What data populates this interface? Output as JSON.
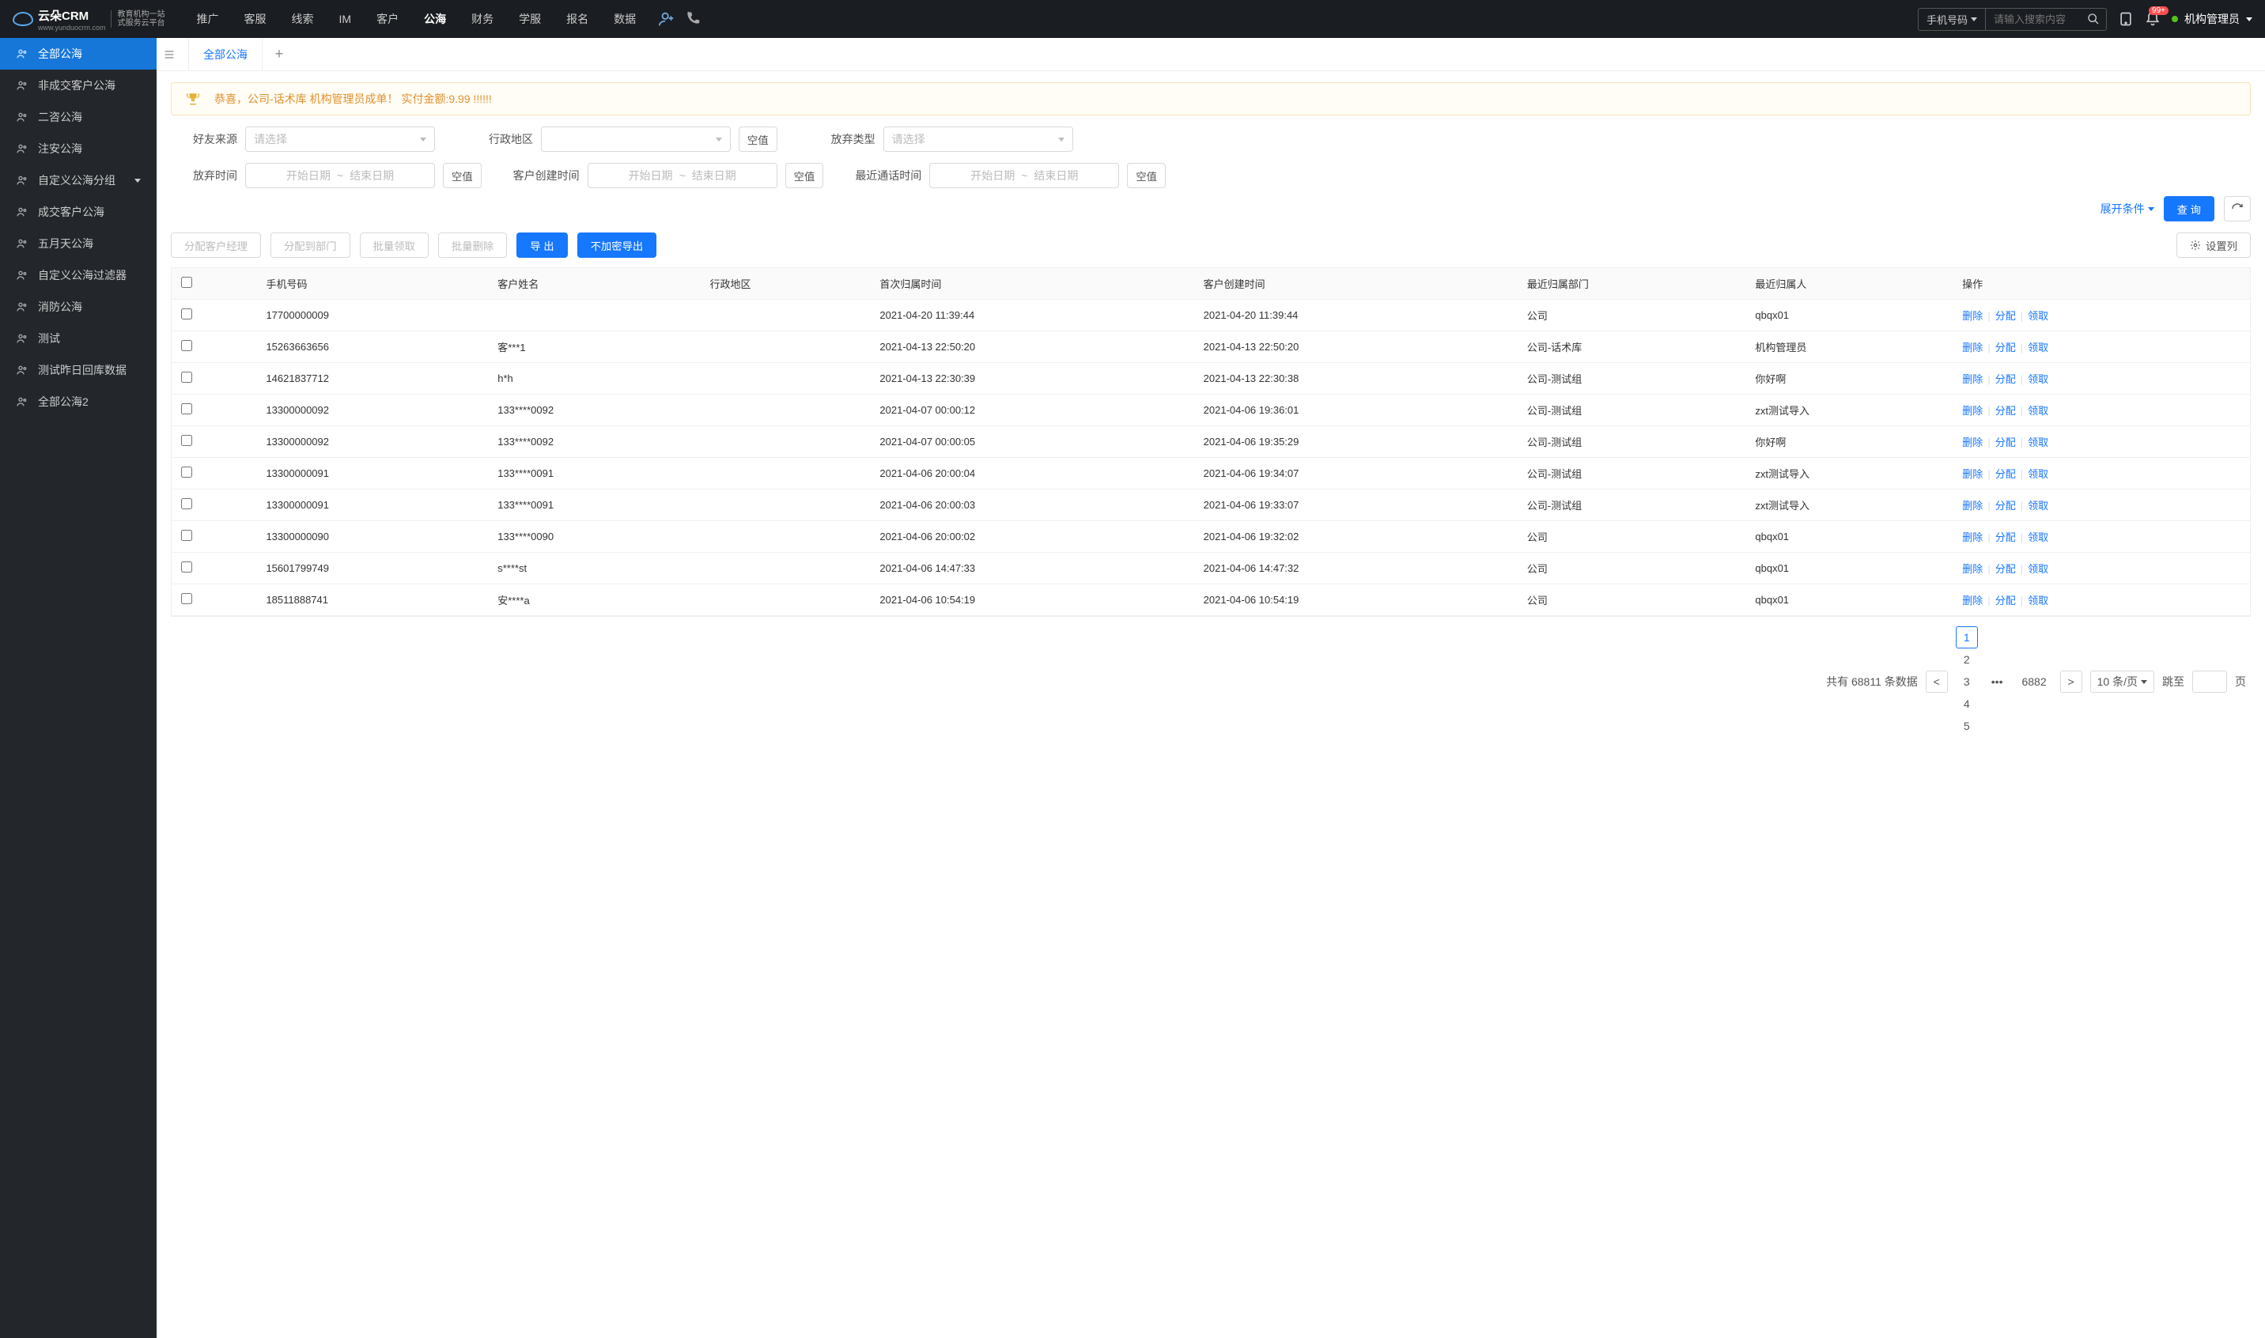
{
  "brand": {
    "name": "云朵CRM",
    "sub1": "教育机构一站",
    "sub2": "式服务云平台",
    "domain": "www.yunduocrm.com"
  },
  "nav": {
    "items": [
      "推广",
      "客服",
      "线索",
      "IM",
      "客户",
      "公海",
      "财务",
      "学服",
      "报名",
      "数据"
    ],
    "active": "公海"
  },
  "topbar": {
    "search_type": "手机号码",
    "search_placeholder": "请输入搜索内容",
    "badge": "99+",
    "user": "机构管理员"
  },
  "sidebar": {
    "items": [
      "全部公海",
      "非成交客户公海",
      "二咨公海",
      "注安公海",
      "自定义公海分组",
      "成交客户公海",
      "五月天公海",
      "自定义公海过滤器",
      "消防公海",
      "测试",
      "测试昨日回库数据",
      "全部公海2"
    ],
    "active": "全部公海",
    "expandable": "自定义公海分组"
  },
  "tabs": {
    "active": "全部公海"
  },
  "banner": {
    "text": "恭喜，公司-话术库  机构管理员成单！  实付金额:9.99 !!!!!!"
  },
  "filters": {
    "labels": {
      "friend_from": "好友来源",
      "region": "行政地区",
      "abandon_type": "放弃类型",
      "abandon_time": "放弃时间",
      "create_time": "客户创建时间",
      "last_call": "最近通话时间"
    },
    "placeholder_select": "请选择",
    "placeholder_start": "开始日期",
    "placeholder_end": "结束日期",
    "empty_btn": "空值",
    "expand": "展开条件",
    "query": "查 询"
  },
  "toolbar": {
    "assign_manager": "分配客户经理",
    "assign_dept": "分配到部门",
    "batch_claim": "批量领取",
    "batch_delete": "批量删除",
    "export": "导 出",
    "export_plain": "不加密导出",
    "set_columns": "设置列"
  },
  "table": {
    "headers": [
      "手机号码",
      "客户姓名",
      "行政地区",
      "首次归属时间",
      "客户创建时间",
      "最近归属部门",
      "最近归属人",
      "操作"
    ],
    "ops": {
      "delete": "删除",
      "assign": "分配",
      "claim": "领取"
    },
    "rows": [
      {
        "phone": "17700000009",
        "name": "",
        "region": "",
        "first": "2021-04-20 11:39:44",
        "created": "2021-04-20 11:39:44",
        "dept": "公司",
        "owner": "qbqx01"
      },
      {
        "phone": "15263663656",
        "name": "客***1",
        "region": "",
        "first": "2021-04-13 22:50:20",
        "created": "2021-04-13 22:50:20",
        "dept": "公司-话术库",
        "owner": "机构管理员"
      },
      {
        "phone": "14621837712",
        "name": "h*h",
        "region": "",
        "first": "2021-04-13 22:30:39",
        "created": "2021-04-13 22:30:38",
        "dept": "公司-测试组",
        "owner": "你好啊"
      },
      {
        "phone": "13300000092",
        "name": "133****0092",
        "region": "",
        "first": "2021-04-07 00:00:12",
        "created": "2021-04-06 19:36:01",
        "dept": "公司-测试组",
        "owner": "zxt测试导入"
      },
      {
        "phone": "13300000092",
        "name": "133****0092",
        "region": "",
        "first": "2021-04-07 00:00:05",
        "created": "2021-04-06 19:35:29",
        "dept": "公司-测试组",
        "owner": "你好啊"
      },
      {
        "phone": "13300000091",
        "name": "133****0091",
        "region": "",
        "first": "2021-04-06 20:00:04",
        "created": "2021-04-06 19:34:07",
        "dept": "公司-测试组",
        "owner": "zxt测试导入"
      },
      {
        "phone": "13300000091",
        "name": "133****0091",
        "region": "",
        "first": "2021-04-06 20:00:03",
        "created": "2021-04-06 19:33:07",
        "dept": "公司-测试组",
        "owner": "zxt测试导入"
      },
      {
        "phone": "13300000090",
        "name": "133****0090",
        "region": "",
        "first": "2021-04-06 20:00:02",
        "created": "2021-04-06 19:32:02",
        "dept": "公司",
        "owner": "qbqx01"
      },
      {
        "phone": "15601799749",
        "name": "s****st",
        "region": "",
        "first": "2021-04-06 14:47:33",
        "created": "2021-04-06 14:47:32",
        "dept": "公司",
        "owner": "qbqx01"
      },
      {
        "phone": "18511888741",
        "name": "安****a",
        "region": "",
        "first": "2021-04-06 10:54:19",
        "created": "2021-04-06 10:54:19",
        "dept": "公司",
        "owner": "qbqx01"
      }
    ]
  },
  "pagination": {
    "total_prefix": "共有",
    "total": "68811",
    "total_suffix": "条数据",
    "pages": [
      "1",
      "2",
      "3",
      "4",
      "5"
    ],
    "last": "6882",
    "per_page": "10 条/页",
    "jump_prefix": "跳至",
    "jump_suffix": "页"
  }
}
